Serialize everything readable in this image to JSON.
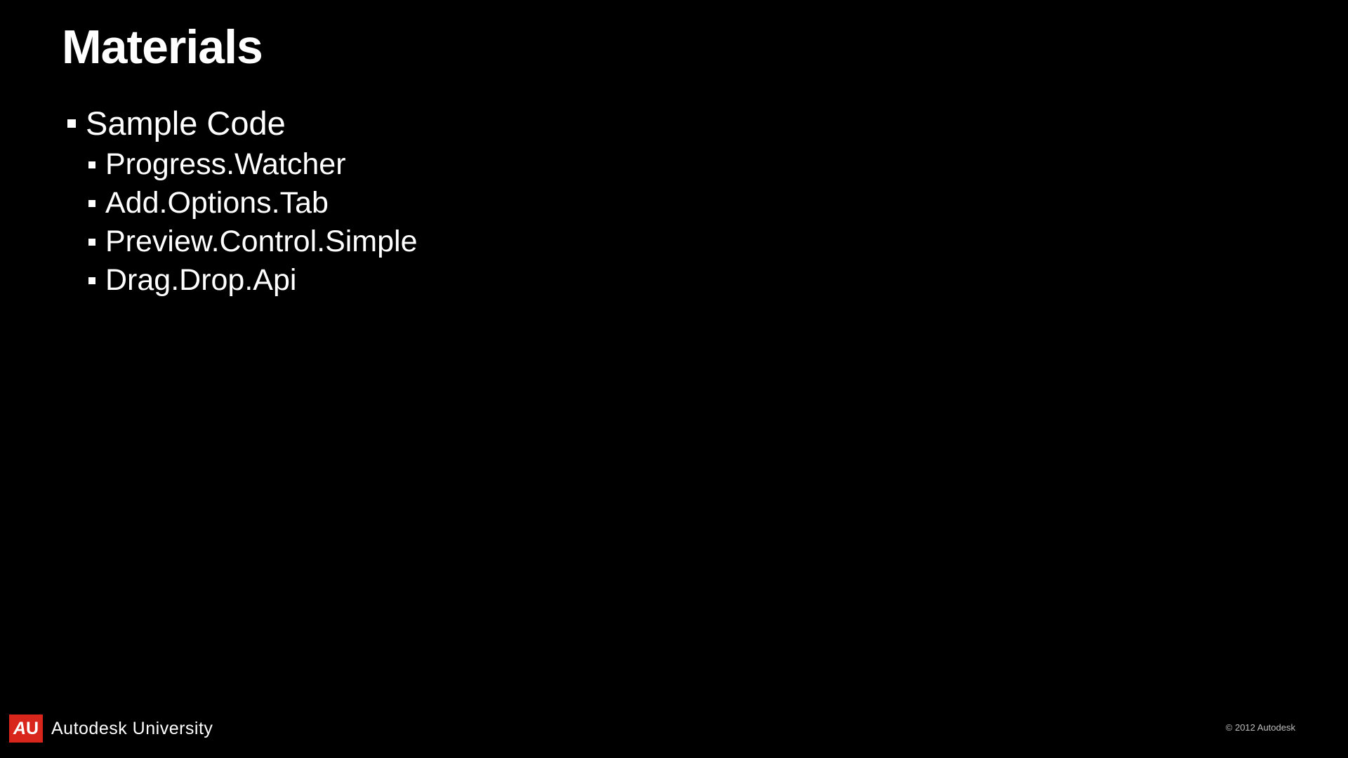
{
  "slide": {
    "title": "Materials",
    "bullets": {
      "level1": "Sample Code",
      "level2": [
        "Progress.Watcher",
        "Add.Options.Tab",
        "Preview.Control.Simple",
        "Drag.Drop.Api"
      ]
    }
  },
  "footer": {
    "logo_letters": "AU",
    "brand": "Autodesk University",
    "copyright": "© 2012 Autodesk"
  },
  "colors": {
    "background": "#000000",
    "text": "#ffffff",
    "accent": "#d9261c"
  }
}
